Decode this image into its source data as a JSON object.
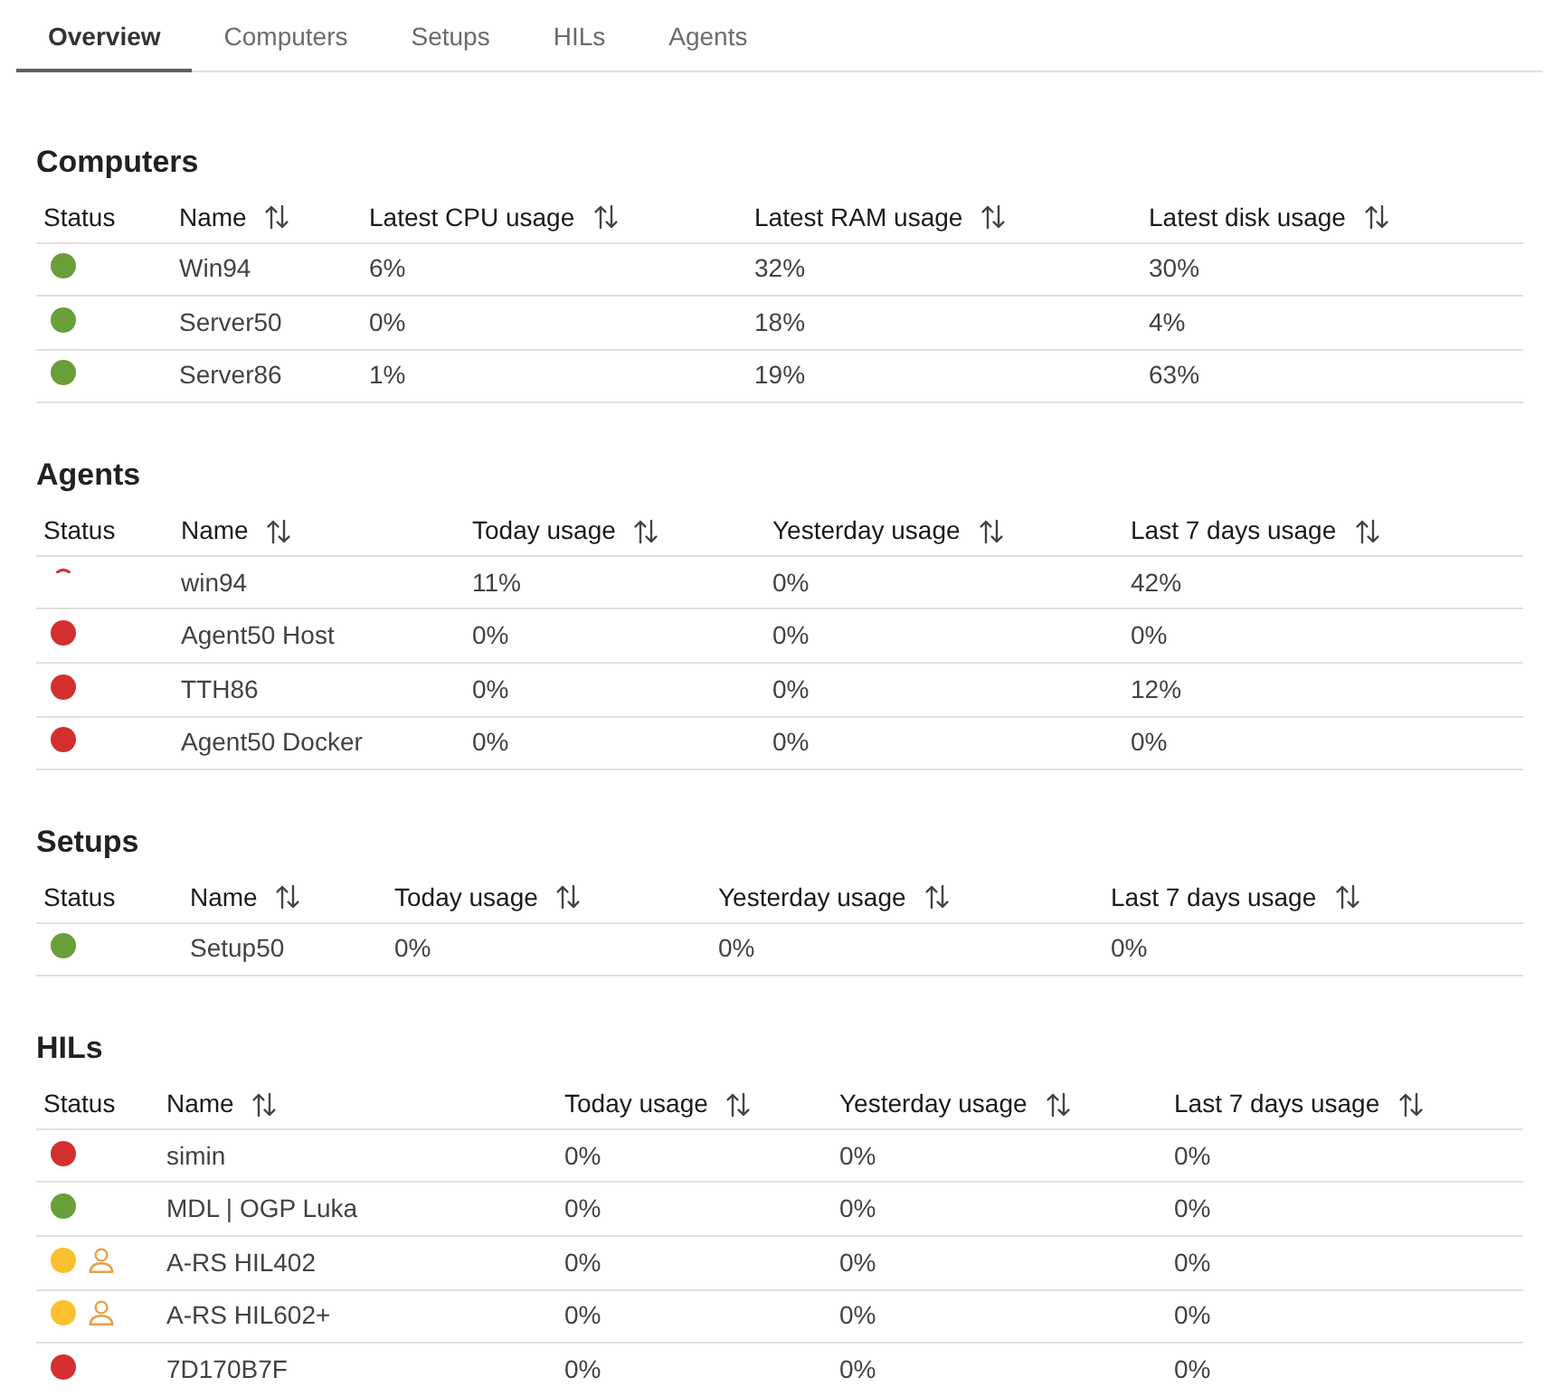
{
  "tabs": [
    {
      "label": "Overview",
      "selected": true
    },
    {
      "label": "Computers",
      "selected": false
    },
    {
      "label": "Setups",
      "selected": false
    },
    {
      "label": "HILs",
      "selected": false
    },
    {
      "label": "Agents",
      "selected": false
    }
  ],
  "sections": [
    {
      "title": "Computers",
      "columns": [
        {
          "label": "Status",
          "sortable": false
        },
        {
          "label": "Name",
          "sortable": true
        },
        {
          "label": "Latest CPU usage",
          "sortable": true
        },
        {
          "label": "Latest RAM usage",
          "sortable": true
        },
        {
          "label": "Latest disk usage",
          "sortable": true
        }
      ],
      "rows": [
        {
          "cells": [
            {
              "kind": "dot",
              "color": "#689f38"
            },
            "Win94",
            "6%",
            "32%",
            "30%"
          ]
        },
        {
          "cells": [
            {
              "kind": "dot",
              "color": "#689f38"
            },
            "Server50",
            "0%",
            "18%",
            "4%"
          ]
        },
        {
          "cells": [
            {
              "kind": "dot",
              "color": "#689f38"
            },
            "Server86",
            "1%",
            "19%",
            "63%"
          ]
        }
      ]
    },
    {
      "title": "Agents",
      "columns": [
        {
          "label": "Status",
          "sortable": false
        },
        {
          "label": "Name",
          "sortable": true
        },
        {
          "label": "Today usage",
          "sortable": true
        },
        {
          "label": "Yesterday usage",
          "sortable": true
        },
        {
          "label": "Last 7 days usage",
          "sortable": true
        }
      ],
      "rows": [
        {
          "cells": [
            {
              "kind": "spinner",
              "color": "#d32f2f"
            },
            "win94",
            "11%",
            "0%",
            "42%"
          ]
        },
        {
          "cells": [
            {
              "kind": "dot",
              "color": "#d32f2f"
            },
            "Agent50 Host",
            "0%",
            "0%",
            "0%"
          ]
        },
        {
          "cells": [
            {
              "kind": "dot",
              "color": "#d32f2f"
            },
            "TTH86",
            "0%",
            "0%",
            "12%"
          ]
        },
        {
          "cells": [
            {
              "kind": "dot",
              "color": "#d32f2f"
            },
            "Agent50 Docker",
            "0%",
            "0%",
            "0%"
          ]
        }
      ]
    },
    {
      "title": "Setups",
      "columns": [
        {
          "label": "Status",
          "sortable": false
        },
        {
          "label": "Name",
          "sortable": true
        },
        {
          "label": "Today usage",
          "sortable": true
        },
        {
          "label": "Yesterday usage",
          "sortable": true
        },
        {
          "label": "Last 7 days usage",
          "sortable": true
        }
      ],
      "rows": [
        {
          "cells": [
            {
              "kind": "dot",
              "color": "#689f38"
            },
            "Setup50",
            "0%",
            "0%",
            "0%"
          ]
        }
      ]
    },
    {
      "title": "HILs",
      "columns": [
        {
          "label": "Status",
          "sortable": false
        },
        {
          "label": "Name",
          "sortable": true
        },
        {
          "label": "Today usage",
          "sortable": true
        },
        {
          "label": "Yesterday usage",
          "sortable": true
        },
        {
          "label": "Last 7 days usage",
          "sortable": true
        }
      ],
      "rows": [
        {
          "cells": [
            {
              "kind": "dot",
              "color": "#d32f2f",
              "user_marker": false
            },
            "simin",
            "0%",
            "0%",
            "0%"
          ]
        },
        {
          "cells": [
            {
              "kind": "dot",
              "color": "#689f38",
              "user_marker": false
            },
            "MDL | OGP Luka",
            "0%",
            "0%",
            "0%"
          ]
        },
        {
          "cells": [
            {
              "kind": "dot",
              "color": "#fbc02d",
              "user_marker": true
            },
            "A-RS HIL402",
            "0%",
            "0%",
            "0%"
          ]
        },
        {
          "cells": [
            {
              "kind": "dot",
              "color": "#fbc02d",
              "user_marker": true
            },
            "A-RS HIL602+",
            "0%",
            "0%",
            "0%"
          ]
        },
        {
          "cells": [
            {
              "kind": "dot",
              "color": "#d32f2f",
              "user_marker": false
            },
            "7D170B7F",
            "0%",
            "0%",
            "0%"
          ]
        }
      ]
    }
  ]
}
